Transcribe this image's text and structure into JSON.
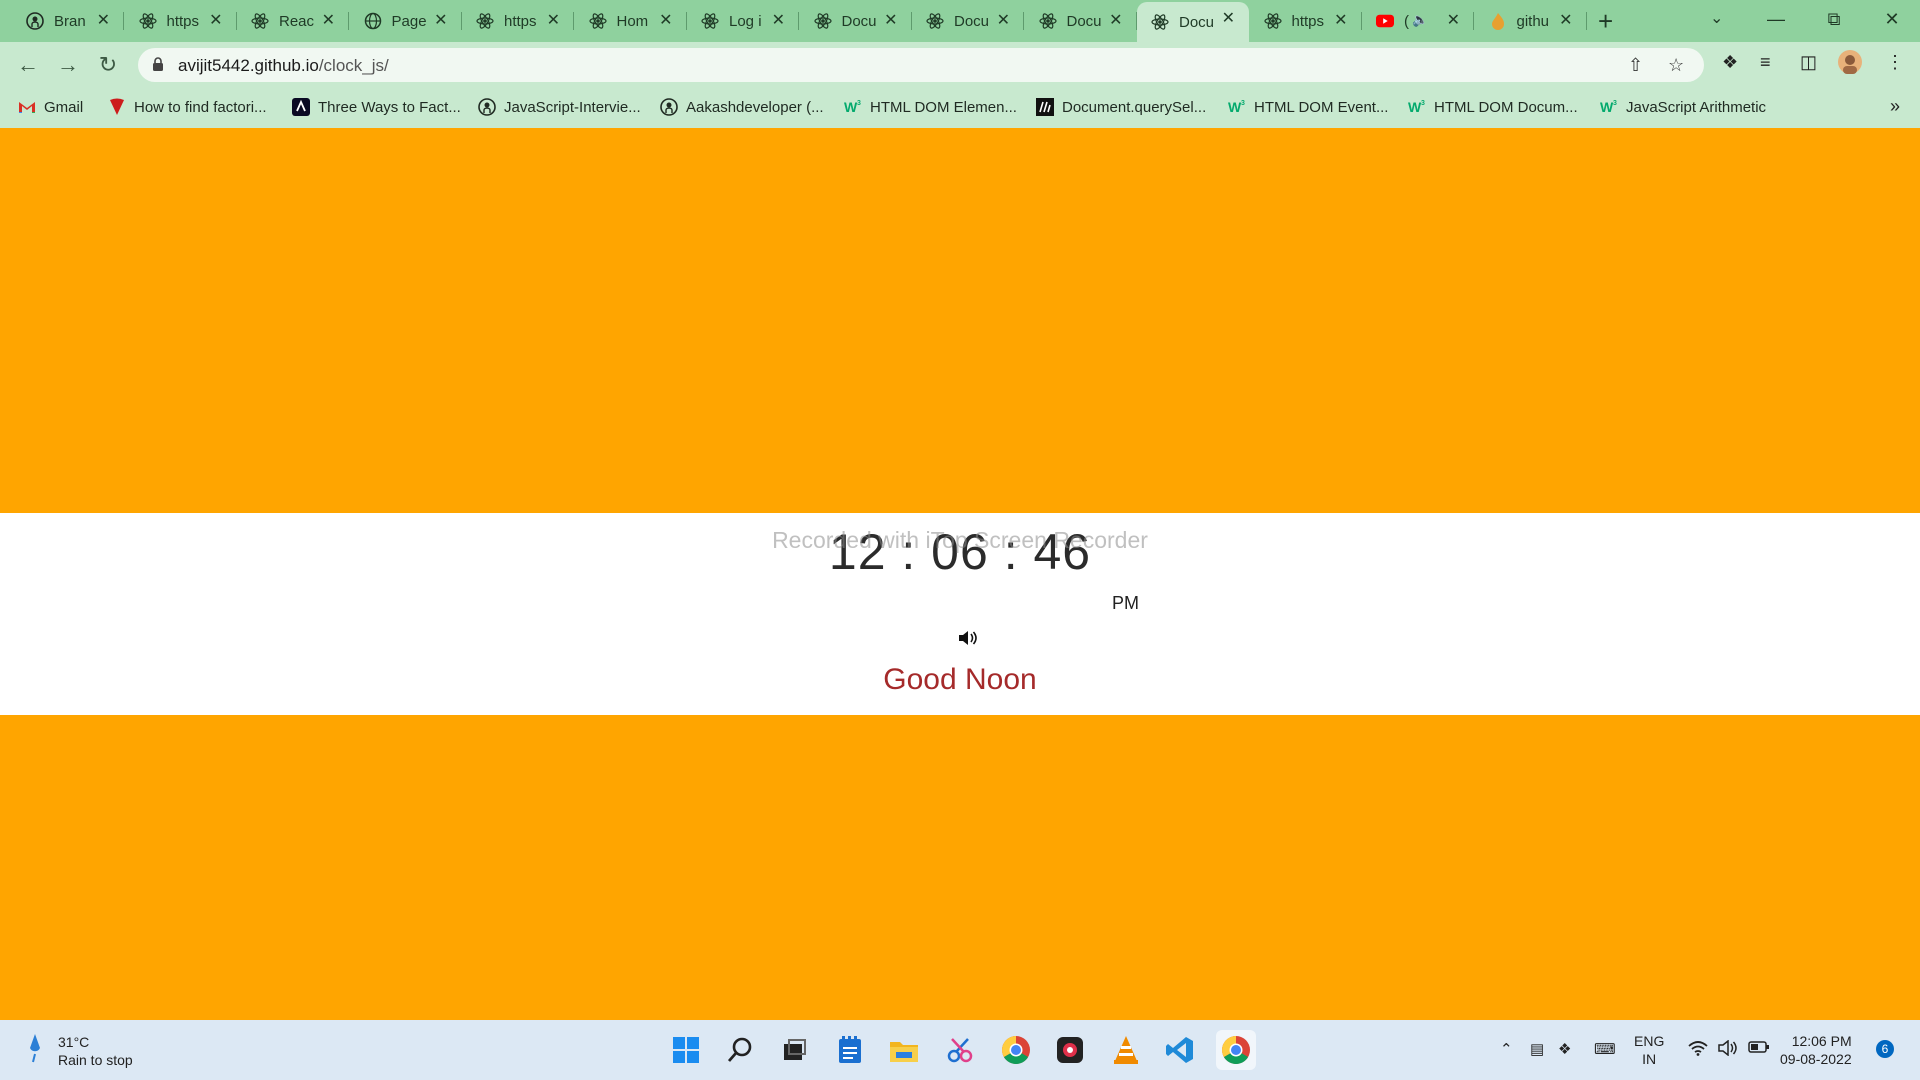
{
  "browser": {
    "tabs": [
      {
        "title": "Bran",
        "icon": "github-icon"
      },
      {
        "title": "https",
        "icon": "react-icon"
      },
      {
        "title": "Reac",
        "icon": "react-icon"
      },
      {
        "title": "Page",
        "icon": "globe-icon"
      },
      {
        "title": "https",
        "icon": "react-icon"
      },
      {
        "title": "Hom",
        "icon": "react-icon"
      },
      {
        "title": "Log i",
        "icon": "react-icon"
      },
      {
        "title": "Docu",
        "icon": "react-icon"
      },
      {
        "title": "Docu",
        "icon": "react-icon"
      },
      {
        "title": "Docu",
        "icon": "react-icon"
      },
      {
        "title": "Docu",
        "icon": "react-icon",
        "active": true
      },
      {
        "title": "https",
        "icon": "react-icon"
      },
      {
        "title": "(",
        "icon": "youtube-icon"
      },
      {
        "title": "githu",
        "icon": "flame-icon"
      }
    ],
    "url": {
      "host": "avijit5442.github.io",
      "path": "/clock_js/"
    },
    "bookmarks": [
      {
        "label": "Gmail",
        "icon": "gmail-icon"
      },
      {
        "label": "How to find factori...",
        "icon": "tesla-icon"
      },
      {
        "label": "Three Ways to Fact...",
        "icon": "freecodecamp-icon"
      },
      {
        "label": "JavaScript-Intervie...",
        "icon": "github-icon"
      },
      {
        "label": "Aakashdeveloper (...",
        "icon": "github-icon"
      },
      {
        "label": "HTML DOM Elemen...",
        "icon": "w3schools-icon"
      },
      {
        "label": "Document.querySel...",
        "icon": "mdn-icon"
      },
      {
        "label": "HTML DOM Event...",
        "icon": "w3schools-icon"
      },
      {
        "label": "HTML DOM Docum...",
        "icon": "w3schools-icon"
      },
      {
        "label": "JavaScript Arithmetic",
        "icon": "w3schools-icon"
      }
    ]
  },
  "page": {
    "time": "12 : 06 : 46",
    "ampm": "PM",
    "greeting": "Good Noon",
    "watermark": "Recorded with iTop Screen Recorder",
    "background_color": "#ffa500",
    "greeting_color": "#a52a2a"
  },
  "taskbar": {
    "weather_temp": "31°C",
    "weather_desc": "Rain to stop",
    "lang_line1": "ENG",
    "lang_line2": "IN",
    "clock_time": "12:06 PM",
    "clock_date": "09-08-2022",
    "notification_count": "6"
  }
}
